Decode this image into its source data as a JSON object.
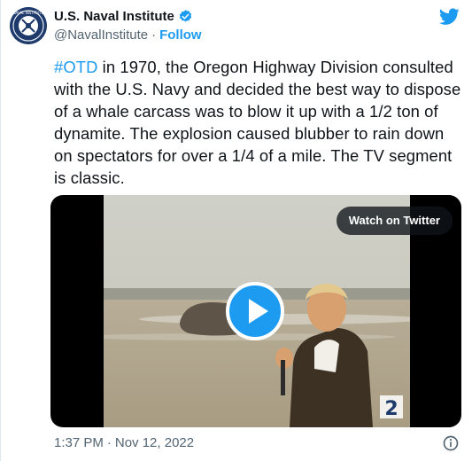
{
  "author": {
    "display_name": "U.S. Naval Institute",
    "handle": "@NavalInstitute",
    "separator": "·",
    "follow_label": "Follow",
    "avatar_icon": "naval-institute-seal-icon",
    "avatar_seal_text": "NAVAL INSTITUTE"
  },
  "tweet": {
    "hashtag": "#OTD",
    "text": " in 1970, the Oregon Highway Division consulted with the U.S. Navy and decided the best way to dispose of a whale carcass was to blow it up with a 1/2 ton of dynamite. The explosion caused blubber to rain down on spectators for over a 1/4 of a mile. The TV segment is classic."
  },
  "media": {
    "watch_label": "Watch on Twitter",
    "play_icon": "play-icon",
    "channel_badge": "2"
  },
  "footer": {
    "time": "1:37 PM",
    "separator": "·",
    "date": "Nov 12, 2022",
    "info_icon": "info-icon"
  },
  "colors": {
    "accent": "#1d9bf0",
    "text": "#0f1419",
    "muted": "#536471"
  }
}
